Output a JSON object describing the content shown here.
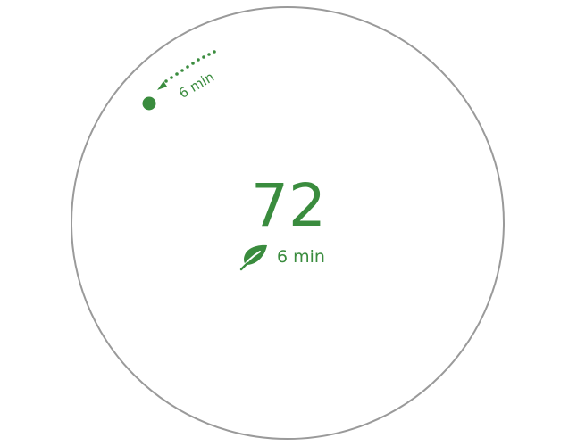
{
  "thermostat": {
    "target_temperature": "72",
    "eco_time_label": "6 min",
    "arc_time_label": "6 min",
    "icon": "leaf-icon",
    "accent_color": "#3a8c3e",
    "ring_color": "#9a9a9a"
  }
}
